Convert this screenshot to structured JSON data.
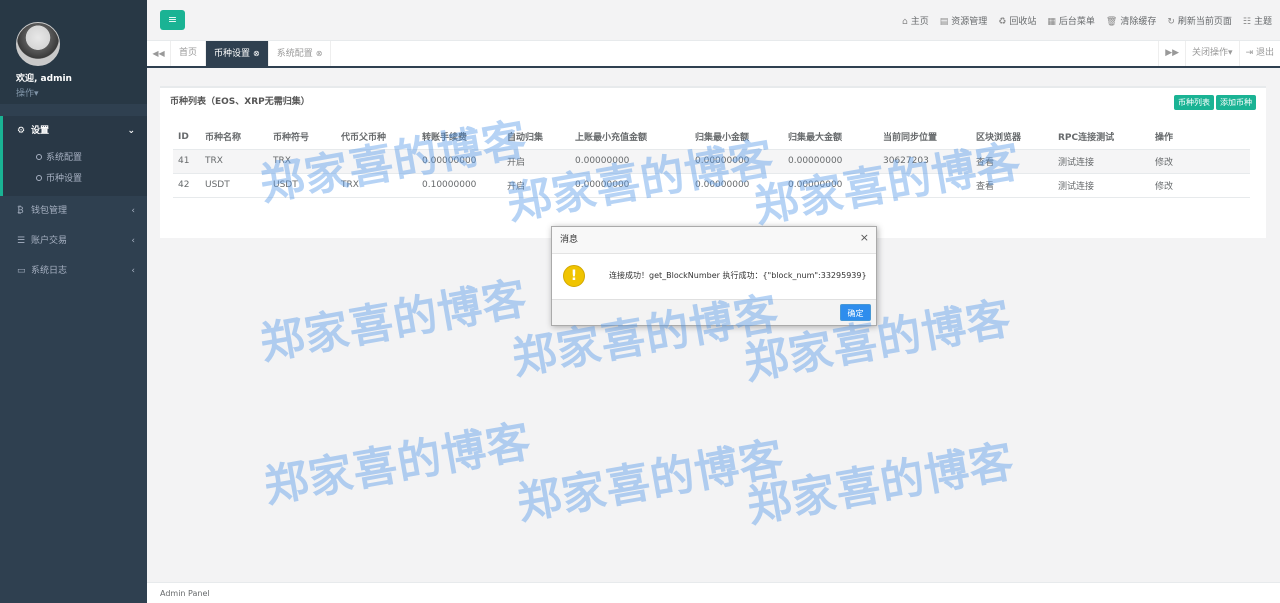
{
  "sidebar": {
    "welcome": "欢迎, admin",
    "ops_label": "操作▾",
    "menu": [
      {
        "icon": "gears",
        "label": "设置",
        "arrow": "⌄"
      },
      {
        "icon": "bitcoin",
        "label": "钱包管理",
        "arrow": "‹"
      },
      {
        "icon": "list",
        "label": "账户交易",
        "arrow": "‹"
      },
      {
        "icon": "desktop",
        "label": "系统日志",
        "arrow": "‹"
      }
    ],
    "submenu": [
      {
        "label": "系统配置"
      },
      {
        "label": "币种设置"
      }
    ]
  },
  "topbar": {
    "links": [
      {
        "icon": "home",
        "label": "主页"
      },
      {
        "icon": "file",
        "label": "资源管理"
      },
      {
        "icon": "recycle",
        "label": "回收站"
      },
      {
        "icon": "th",
        "label": "后台菜单"
      },
      {
        "icon": "trash",
        "label": "清除缓存"
      },
      {
        "icon": "refresh",
        "label": "刷新当前页面"
      },
      {
        "icon": "th-list",
        "label": "主题"
      }
    ]
  },
  "tabs": {
    "items": [
      {
        "label": "首页"
      },
      {
        "label": "币种设置"
      },
      {
        "label": "系统配置"
      }
    ],
    "close_ops": "关闭操作▾",
    "logout": "退出"
  },
  "panel": {
    "title": "币种列表（EOS、XRP无需归集）",
    "btn_list": "币种列表",
    "btn_add": "添加币种",
    "columns": [
      "ID",
      "币种名称",
      "币种符号",
      "代币父币种",
      "转账手续费",
      "自动归集",
      "上账最小充值金额",
      "归集最小金额",
      "归集最大金额",
      "当前同步位置",
      "区块浏览器",
      "RPC连接测试",
      "操作"
    ],
    "rows": [
      {
        "id": "41",
        "name": "TRX",
        "symbol": "TRX",
        "parent": "",
        "fee": "0.00000000",
        "auto": "开启",
        "min_deposit": "0.00000000",
        "min_collect": "0.00000000",
        "max_collect": "0.00000000",
        "sync": "30627203",
        "explorer": "查看",
        "rpc": "测试连接",
        "op": "修改"
      },
      {
        "id": "42",
        "name": "USDT",
        "symbol": "USDT",
        "parent": "TRX",
        "fee": "0.10000000",
        "auto": "开启",
        "min_deposit": "0.00000000",
        "min_collect": "0.00000000",
        "max_collect": "0.00000000",
        "sync": "",
        "explorer": "查看",
        "rpc": "测试连接",
        "op": "修改"
      }
    ]
  },
  "dialog": {
    "title": "消息",
    "message": "连接成功！get_BlockNumber 执行成功：{\"block_num\":33295939}",
    "ok": "确定",
    "close": "×"
  },
  "watermark": "郑家喜的博客",
  "footer": "Admin Panel"
}
